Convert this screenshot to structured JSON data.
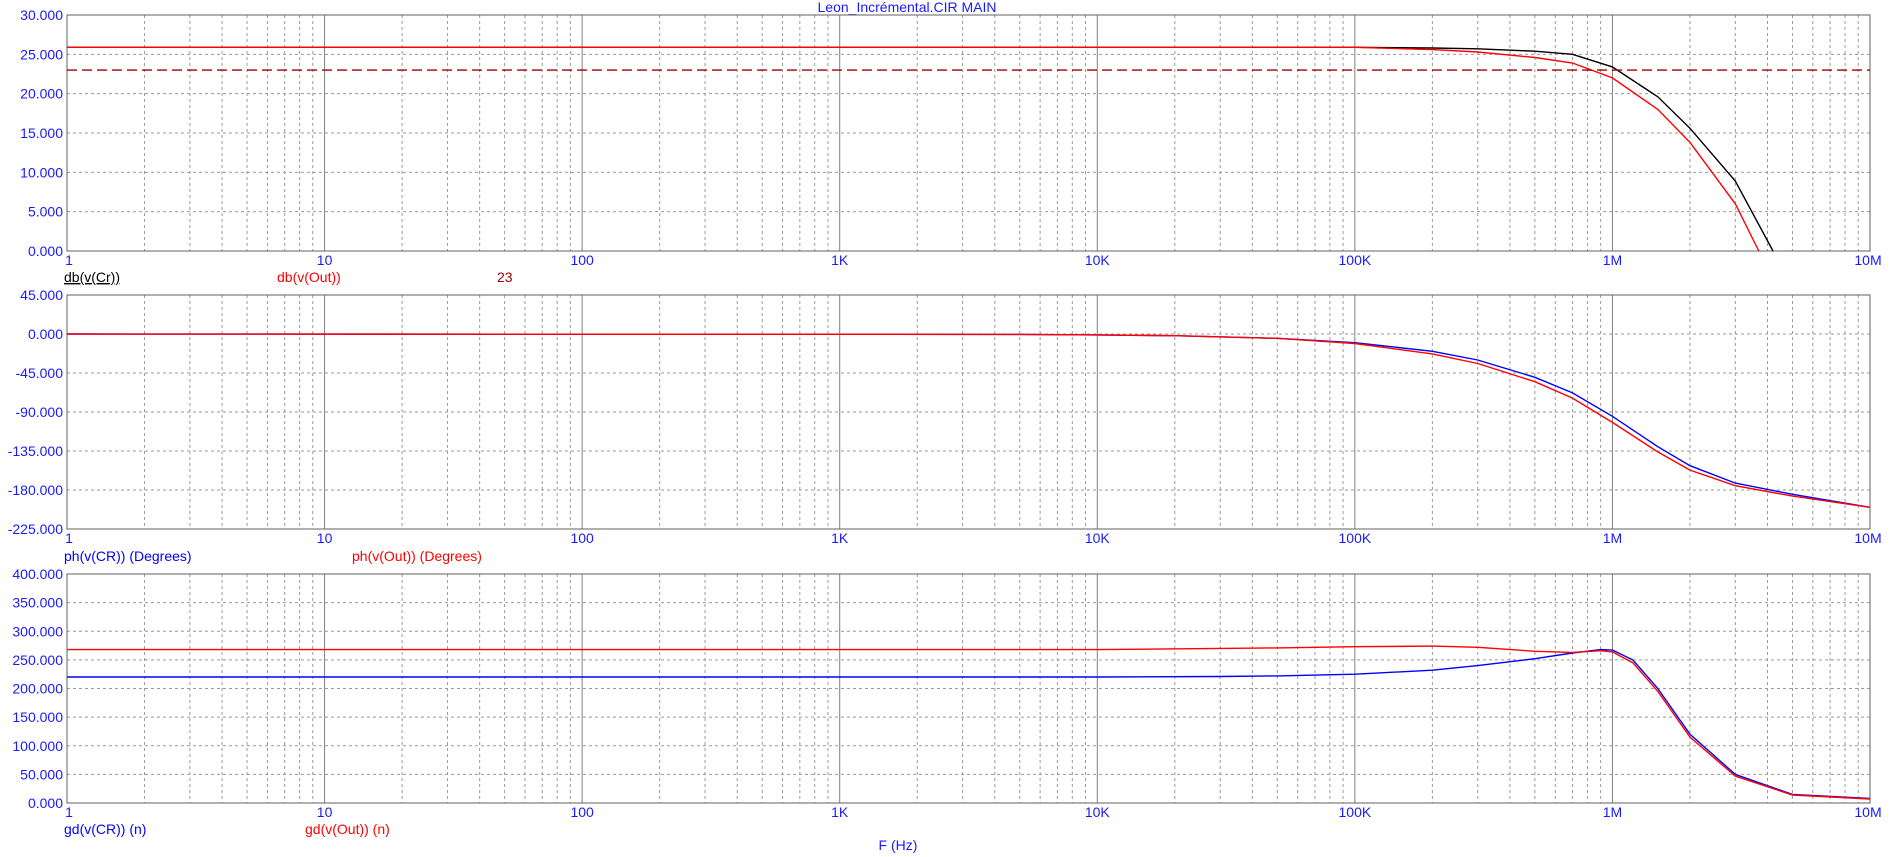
{
  "window": {
    "title": "Leon_Incrémental.CIR MAIN"
  },
  "footer": {
    "x_axis_label": "F (Hz)"
  },
  "colors": {
    "axis_text": "#1a1aff",
    "black": "#000000",
    "red": "#ff0000",
    "blue": "#0000ff",
    "dark_red": "#a00000",
    "grid": "#9a9a9a"
  },
  "chart_data": [
    {
      "type": "line",
      "x_scale": "log",
      "xlim": [
        1,
        10000000
      ],
      "ylim": [
        0,
        30
      ],
      "grid": true,
      "x_tick_labels": [
        "1",
        "10",
        "100",
        "1K",
        "10K",
        "100K",
        "1M",
        "10M"
      ],
      "y_tick_labels": [
        "30.000",
        "25.000",
        "20.000",
        "15.000",
        "10.000",
        "5.000",
        "0.000"
      ],
      "legend_placement": "below-left",
      "series": [
        {
          "name": "db(v(Cr))",
          "color": "#000000",
          "underline": true,
          "x": [
            1,
            100000,
            200000,
            300000,
            500000,
            700000,
            1000000,
            1500000,
            2000000,
            3000000,
            4200000
          ],
          "y": [
            25.9,
            25.9,
            25.8,
            25.7,
            25.4,
            25.0,
            23.4,
            19.6,
            15.6,
            8.9,
            0
          ]
        },
        {
          "name": "db(v(Out))",
          "color": "#ff0000",
          "x": [
            1,
            100000,
            200000,
            300000,
            500000,
            700000,
            1000000,
            1500000,
            2000000,
            3000000,
            3700000
          ],
          "y": [
            25.9,
            25.9,
            25.6,
            25.3,
            24.6,
            23.9,
            22.0,
            18.0,
            13.8,
            6.0,
            0
          ]
        },
        {
          "name": "23",
          "color": "#a00000",
          "dashed": true,
          "x": [
            1,
            10000000
          ],
          "y": [
            23,
            23
          ]
        }
      ]
    },
    {
      "type": "line",
      "x_scale": "log",
      "xlim": [
        1,
        10000000
      ],
      "ylim": [
        -225,
        45
      ],
      "grid": true,
      "x_tick_labels": [
        "1",
        "10",
        "100",
        "1K",
        "10K",
        "100K",
        "1M",
        "10M"
      ],
      "y_tick_labels": [
        "45.000",
        "0.000",
        "-45.000",
        "-90.000",
        "-135.000",
        "-180.000",
        "-225.000"
      ],
      "legend_placement": "below-left",
      "series": [
        {
          "name": "ph(v(CR)) (Degrees)",
          "color": "#0000ff",
          "x": [
            1,
            5000,
            10000,
            20000,
            50000,
            100000,
            200000,
            300000,
            500000,
            700000,
            1000000,
            1500000,
            2000000,
            3000000,
            5000000,
            10000000
          ],
          "y": [
            0,
            -0.5,
            -1,
            -2,
            -5,
            -10,
            -20,
            -30,
            -50,
            -68,
            -95,
            -130,
            -152,
            -172,
            -185,
            -200
          ]
        },
        {
          "name": "ph(v(Out)) (Degrees)",
          "color": "#ff0000",
          "x": [
            1,
            5000,
            10000,
            20000,
            50000,
            100000,
            200000,
            300000,
            500000,
            700000,
            1000000,
            1500000,
            2000000,
            3000000,
            5000000,
            10000000
          ],
          "y": [
            0,
            -0.5,
            -1,
            -2,
            -5,
            -11,
            -23,
            -34,
            -55,
            -74,
            -102,
            -136,
            -157,
            -175,
            -187,
            -200
          ]
        }
      ]
    },
    {
      "type": "line",
      "x_scale": "log",
      "xlim": [
        1,
        10000000
      ],
      "ylim": [
        0,
        400
      ],
      "grid": true,
      "x_tick_labels": [
        "1",
        "10",
        "100",
        "1K",
        "10K",
        "100K",
        "1M",
        "10M"
      ],
      "y_tick_labels": [
        "400.000",
        "350.000",
        "300.000",
        "250.000",
        "200.000",
        "150.000",
        "100.000",
        "50.000",
        "0.000"
      ],
      "legend_placement": "below-left",
      "series": [
        {
          "name": "gd(v(CR)) (n)",
          "color": "#0000ff",
          "x": [
            1,
            10000,
            30000,
            50000,
            100000,
            200000,
            300000,
            500000,
            700000,
            900000,
            1000000,
            1200000,
            1500000,
            2000000,
            3000000,
            5000000,
            10000000
          ],
          "y": [
            220,
            220,
            221,
            222,
            225,
            232,
            240,
            252,
            262,
            268,
            267,
            250,
            200,
            120,
            50,
            15,
            8
          ]
        },
        {
          "name": "gd(v(Out)) (n)",
          "color": "#ff0000",
          "x": [
            1,
            10000,
            30000,
            50000,
            100000,
            200000,
            300000,
            500000,
            700000,
            900000,
            1000000,
            1200000,
            1500000,
            2000000,
            3000000,
            5000000,
            10000000
          ],
          "y": [
            268,
            268,
            270,
            271,
            273,
            274,
            272,
            265,
            263,
            266,
            264,
            245,
            195,
            115,
            47,
            14,
            7
          ]
        }
      ]
    }
  ]
}
